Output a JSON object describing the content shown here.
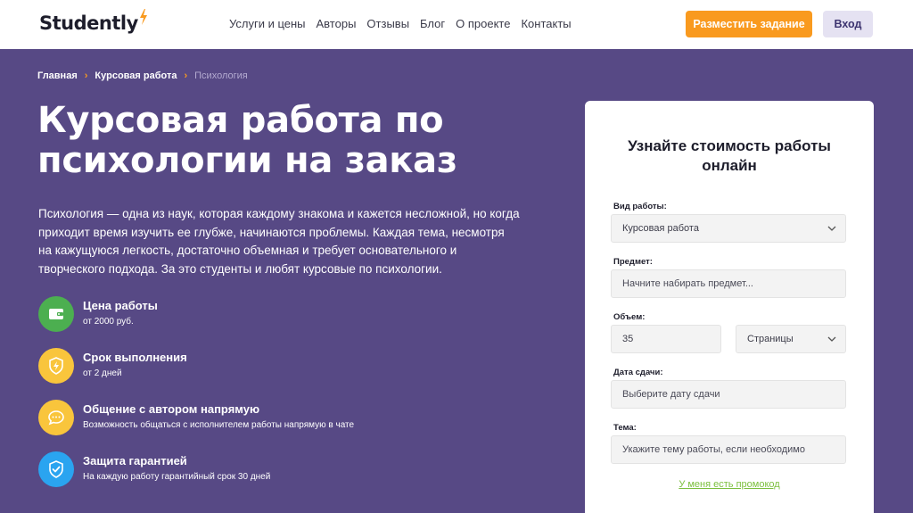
{
  "header": {
    "logo": "Studently",
    "nav": [
      "Услуги и цены",
      "Авторы",
      "Отзывы",
      "Блог",
      "О проекте",
      "Контакты"
    ],
    "order_button": "Разместить задание",
    "login_button": "Вход"
  },
  "breadcrumb": [
    "Главная",
    "Курсовая работа",
    "Психология"
  ],
  "hero": {
    "title": "Курсовая работа по психологии на заказ",
    "intro": "Психология — одна из наук, которая каждому знакома и кажется несложной, но когда приходит время изучить ее глубже, начинаются проблемы. Каждая тема, несмотря на кажущуюся легкость, достаточно объемная и требует основательного и творческого подхода. За это студенты и любят курсовые по психологии."
  },
  "features": [
    {
      "title": "Цена работы",
      "subtitle": "от 2000 руб.",
      "icon": "wallet-icon",
      "color": "#4caf50"
    },
    {
      "title": "Срок выполнения",
      "subtitle": "от 2 дней",
      "icon": "lightning-shield-icon",
      "color": "#f9c53c"
    },
    {
      "title": "Общение с автором напрямую",
      "subtitle": "Возможность общаться с исполнителем работы напрямую в чате",
      "icon": "chat-icon",
      "color": "#f9c53c"
    },
    {
      "title": "Защита гарантией",
      "subtitle": "На каждую работу гарантийный срок 30 дней",
      "icon": "shield-check-icon",
      "color": "#2aa4f0"
    }
  ],
  "form": {
    "title": "Узнайте стоимость работы онлайн",
    "work_type_label": "Вид работы:",
    "work_type_value": "Курсовая работа",
    "subject_label": "Предмет:",
    "subject_placeholder": "Начните набирать предмет...",
    "volume_label": "Объем:",
    "volume_value": "35",
    "volume_unit": "Страницы",
    "deadline_label": "Дата сдачи:",
    "deadline_placeholder": "Выберите дату сдачи",
    "topic_label": "Тема:",
    "topic_placeholder": "Укажите тему работы, если необходимо",
    "promo_link": "У меня есть промокод"
  },
  "colors": {
    "hero_bg": "#574985",
    "accent": "#f99a1f",
    "promo": "#7cbf3e"
  }
}
